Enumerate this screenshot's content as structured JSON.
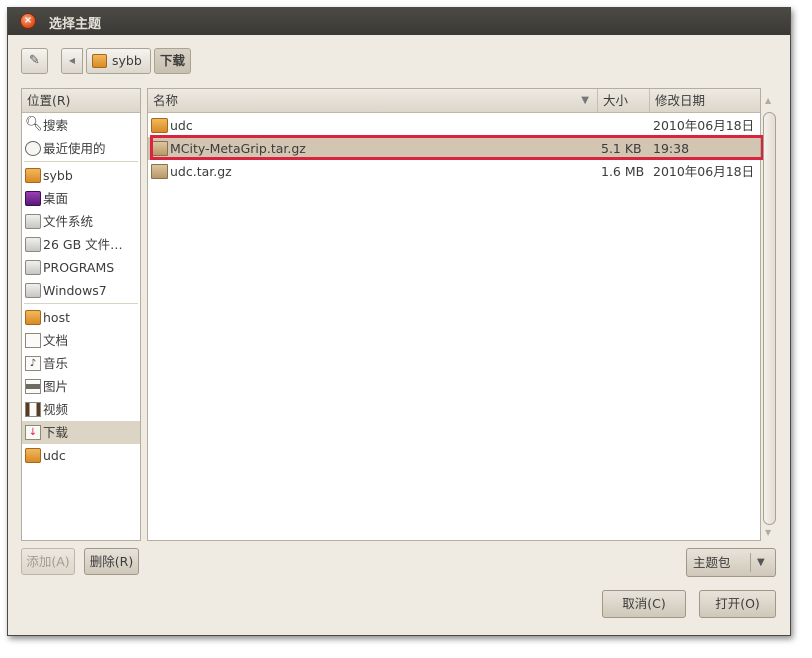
{
  "window": {
    "title": "选择主题"
  },
  "toolbar": {
    "edit_icon": "pencil-icon",
    "back_icon": "triangle-left-icon",
    "breadcrumbs": [
      {
        "label": "sybb",
        "icon": "home-folder-icon"
      },
      {
        "label": "下载"
      }
    ]
  },
  "places": {
    "header": "位置(R)",
    "items": [
      {
        "label": "搜索",
        "icon": "search-icon"
      },
      {
        "label": "最近使用的",
        "icon": "recent-icon"
      },
      {
        "label": "sybb",
        "icon": "home-folder-icon"
      },
      {
        "label": "桌面",
        "icon": "desktop-icon"
      },
      {
        "label": "文件系统",
        "icon": "drive-icon"
      },
      {
        "label": "26 GB 文件…",
        "icon": "drive-icon"
      },
      {
        "label": "PROGRAMS",
        "icon": "drive-icon"
      },
      {
        "label": "Windows7",
        "icon": "drive-icon"
      },
      {
        "label": "host",
        "icon": "folder-icon"
      },
      {
        "label": "文档",
        "icon": "documents-folder-icon"
      },
      {
        "label": "音乐",
        "icon": "music-folder-icon"
      },
      {
        "label": "图片",
        "icon": "pictures-folder-icon"
      },
      {
        "label": "视频",
        "icon": "videos-folder-icon"
      },
      {
        "label": "下载",
        "icon": "downloads-folder-icon",
        "selected": true
      },
      {
        "label": "udc",
        "icon": "folder-icon"
      }
    ]
  },
  "files": {
    "columns": {
      "name": "名称",
      "size": "大小",
      "modified": "修改日期"
    },
    "sort_icon": "sort-down-icon",
    "rows": [
      {
        "name": "udc",
        "size": "",
        "modified": "2010年06月18日",
        "icon": "folder-icon"
      },
      {
        "name": "MCity-MetaGrip.tar.gz",
        "size": "5.1 KB",
        "modified": "19:38",
        "icon": "archive-icon",
        "selected": true
      },
      {
        "name": "udc.tar.gz",
        "size": "1.6 MB",
        "modified": "2010年06月18日",
        "icon": "archive-icon"
      }
    ]
  },
  "buttons": {
    "add": "添加(A)",
    "remove": "删除(R)",
    "filter": "主题包",
    "cancel": "取消(C)",
    "open": "打开(O)"
  },
  "colors": {
    "titlebar": "#3c3b37",
    "window_bg": "#f0ebe2",
    "selection": "#d2c5b1",
    "highlight_box": "#d9233f"
  }
}
